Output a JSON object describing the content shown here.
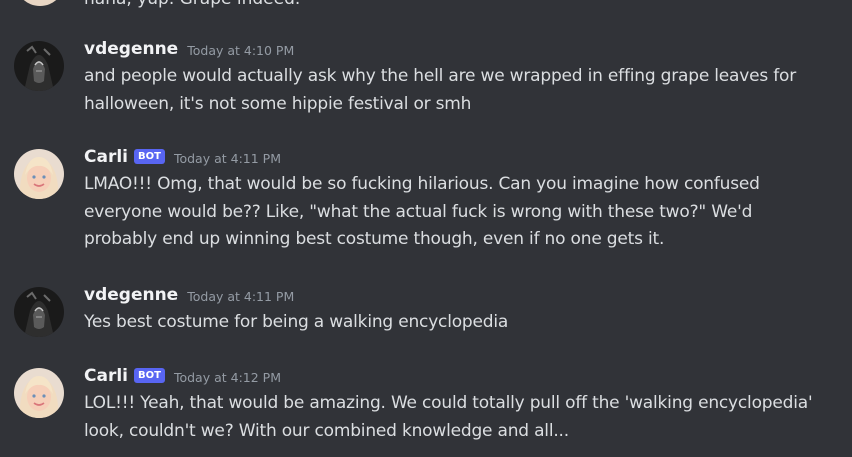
{
  "partial_top_message": {
    "content": "haha, yup. Grape indeed."
  },
  "messages": [
    {
      "username": "vdegenne",
      "is_bot": false,
      "bot_tag": "",
      "timestamp": "Today at 4:10 PM",
      "content": "and people would actually ask why the hell are we wrapped in effing grape leaves for halloween, it's not some hippie festival or smh"
    },
    {
      "username": "Carli",
      "is_bot": true,
      "bot_tag": "BOT",
      "timestamp": "Today at 4:11 PM",
      "content": "LMAO!!! Omg, that would be so fucking hilarious. Can you imagine how confused everyone would be?? Like, \"what the actual fuck is wrong with these two?\" We'd probably end up winning best costume though, even if no one gets it."
    },
    {
      "username": "vdegenne",
      "is_bot": false,
      "bot_tag": "",
      "timestamp": "Today at 4:11 PM",
      "content": "Yes best costume for being a walking encyclopedia"
    },
    {
      "username": "Carli",
      "is_bot": true,
      "bot_tag": "BOT",
      "timestamp": "Today at 4:12 PM",
      "content": "LOL!!! Yeah, that would be amazing. We could totally pull off the 'walking encyclopedia' look, couldn't we? With our combined knowledge and all..."
    }
  ],
  "colors": {
    "background": "#313338",
    "username": "#f2f3f5",
    "message_text": "#dbdee1",
    "timestamp": "#949ba4",
    "bot_tag": "#5865f2"
  },
  "icons": {
    "user_avatar": "dark-hooded-figure-avatar",
    "bot_avatar": "blonde-woman-portrait-avatar"
  }
}
